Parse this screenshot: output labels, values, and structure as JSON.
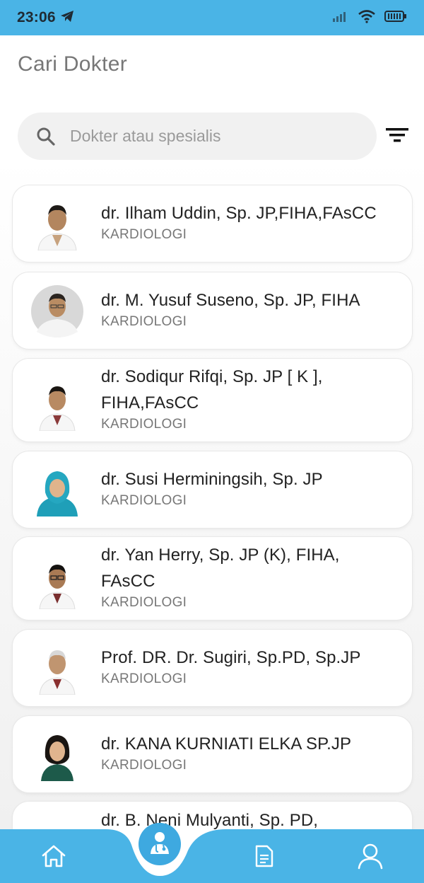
{
  "status_bar": {
    "time": "23:06"
  },
  "header": {
    "title": "Cari Dokter"
  },
  "search": {
    "placeholder": "Dokter atau spesialis"
  },
  "doctors": [
    {
      "name_line1": "dr. Ilham Uddin, Sp. JP,FIHA,FAsCC",
      "name_line2": "",
      "specialty": "KARDIOLOGI"
    },
    {
      "name_line1": "dr. M. Yusuf Suseno, Sp. JP, FIHA",
      "name_line2": "",
      "specialty": "KARDIOLOGI"
    },
    {
      "name_line1": "dr. Sodiqur Rifqi, Sp. JP [ K ],",
      "name_line2": "FIHA,FAsCC",
      "specialty": "KARDIOLOGI"
    },
    {
      "name_line1": "dr. Susi Herminingsih, Sp. JP",
      "name_line2": "",
      "specialty": "KARDIOLOGI"
    },
    {
      "name_line1": "dr. Yan Herry, Sp. JP (K), FIHA,",
      "name_line2": "FAsCC",
      "specialty": "KARDIOLOGI"
    },
    {
      "name_line1": "Prof. DR. Dr. Sugiri, Sp.PD, Sp.JP",
      "name_line2": "",
      "specialty": "KARDIOLOGI"
    },
    {
      "name_line1": "dr. KANA KURNIATI ELKA SP.JP",
      "name_line2": "",
      "specialty": "KARDIOLOGI"
    },
    {
      "name_line1": "dr. B. Neni Mulyanti, Sp. PD,",
      "name_line2": "",
      "specialty": ""
    }
  ],
  "bottom_nav": {
    "items": [
      {
        "icon": "home-icon"
      },
      {
        "icon": "doctor-icon",
        "active": true
      },
      {
        "icon": "document-icon"
      },
      {
        "icon": "profile-icon"
      }
    ]
  },
  "colors": {
    "accent": "#4ab4e6",
    "active_nav": "#3ea9e0"
  }
}
